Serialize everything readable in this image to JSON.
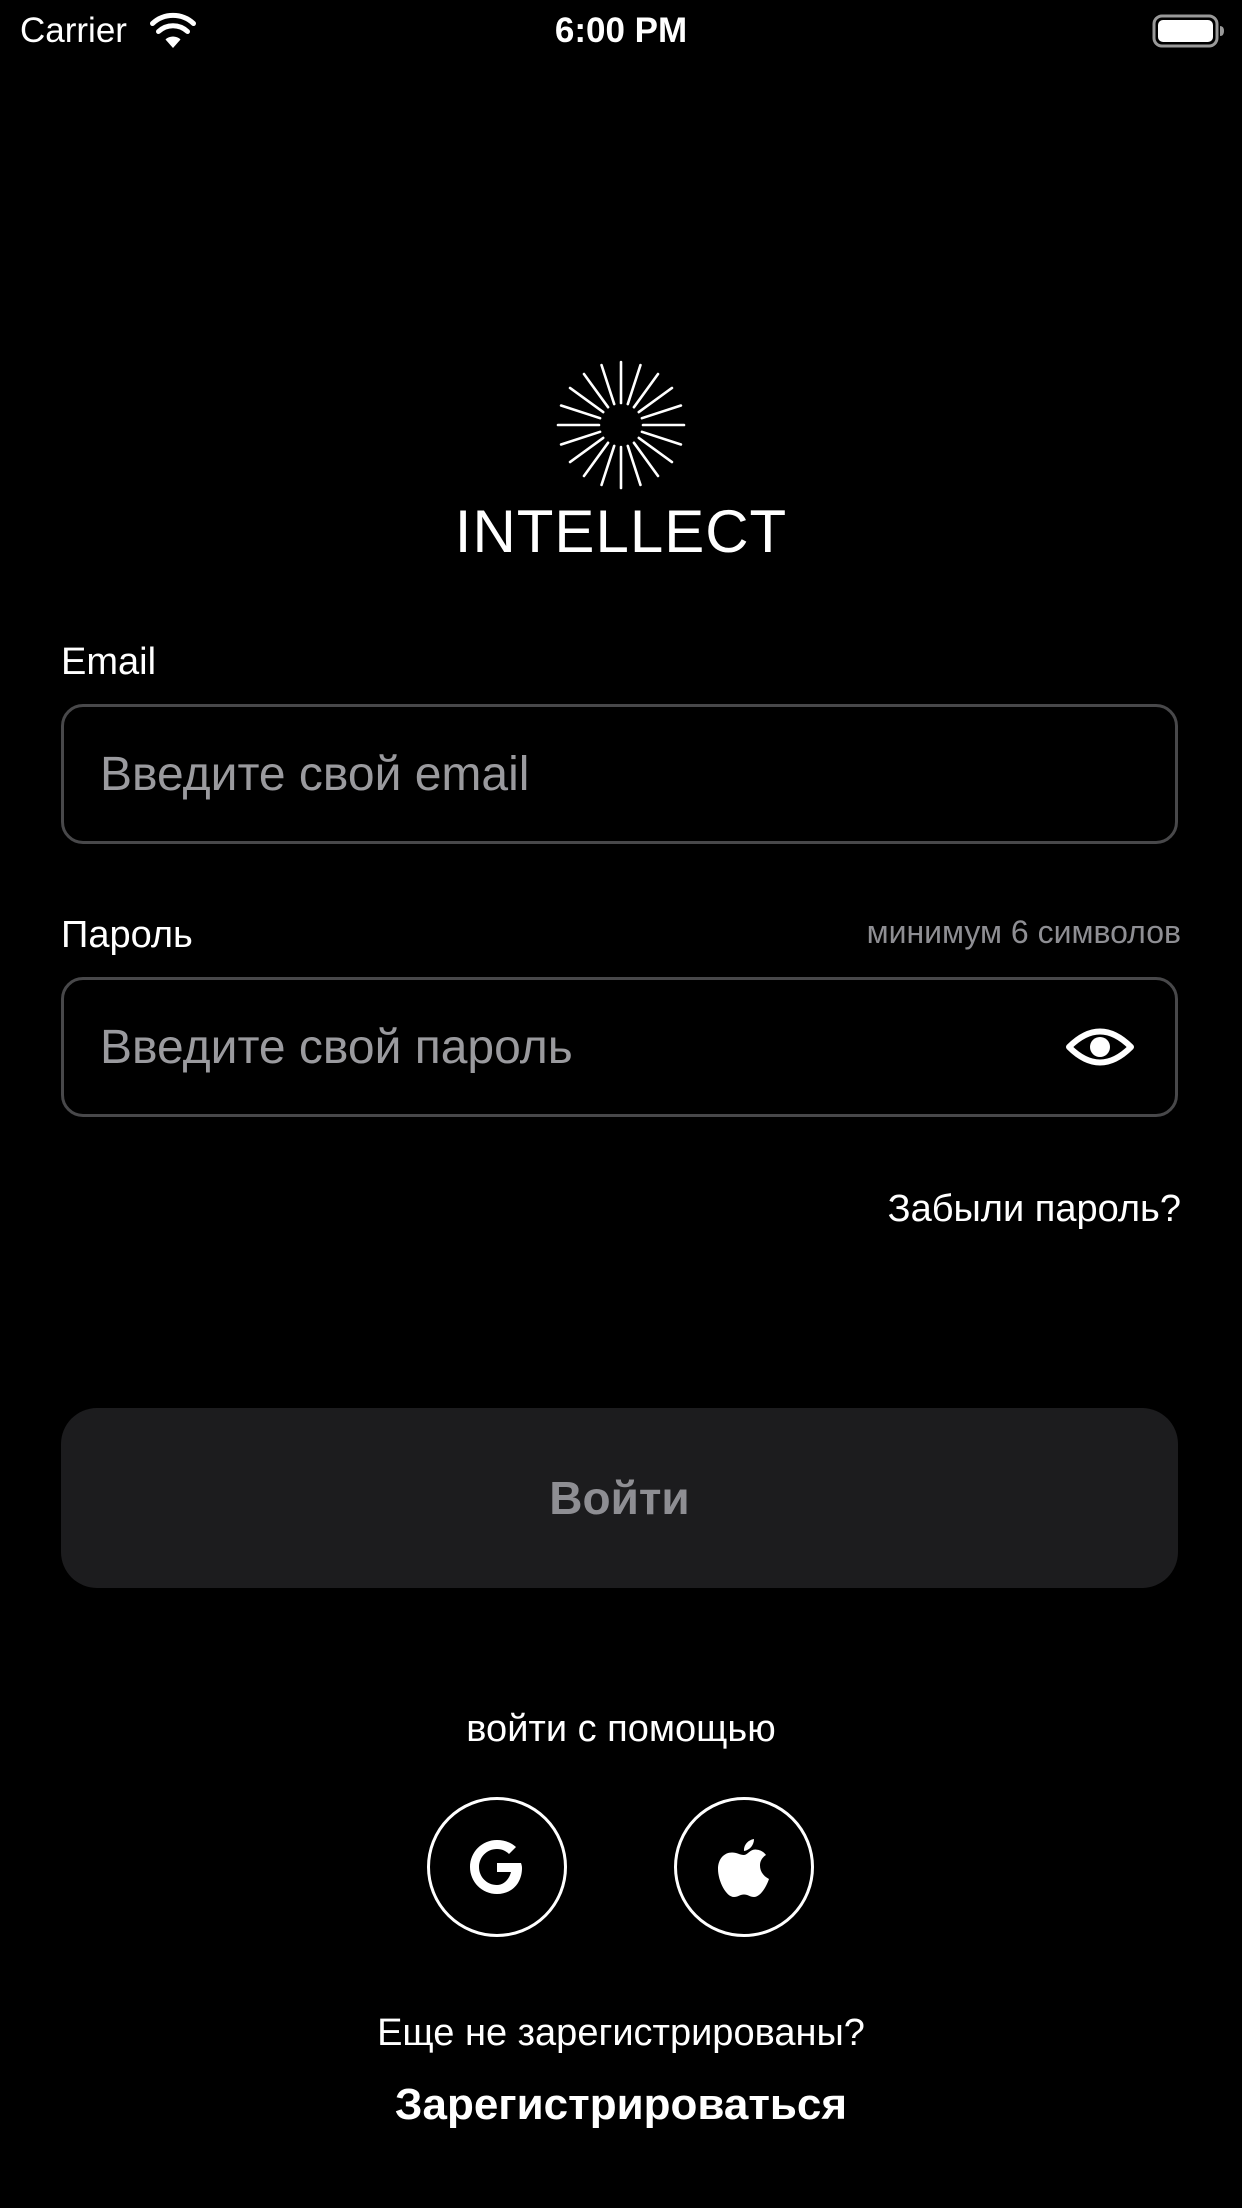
{
  "status_bar": {
    "carrier": "Carrier",
    "time": "6:00 PM",
    "wifi_icon": "wifi-icon",
    "battery_icon": "battery-full-icon"
  },
  "logo": {
    "icon": "sunburst-logo-icon",
    "text": "INTELLECT"
  },
  "email": {
    "label": "Email",
    "placeholder": "Введите свой email",
    "value": ""
  },
  "password": {
    "label": "Пароль",
    "hint": "минимум 6 символов",
    "placeholder": "Введите свой пароль",
    "value": "",
    "toggle_icon": "eye-icon"
  },
  "forgot_password": "Забыли пароль?",
  "login_button": "Войти",
  "social": {
    "caption": "войти с помощью",
    "providers": [
      {
        "name": "Google",
        "icon": "google-icon"
      },
      {
        "name": "Apple",
        "icon": "apple-icon"
      }
    ]
  },
  "register": {
    "question": "Еще не зарегистрированы?",
    "link": "Зарегистрироваться"
  },
  "colors": {
    "background": "#000000",
    "text": "#ffffff",
    "hint": "#8e8e93",
    "input_border": "#48484a",
    "button_bg": "#1c1c1e",
    "button_text": "#8e8e93"
  }
}
